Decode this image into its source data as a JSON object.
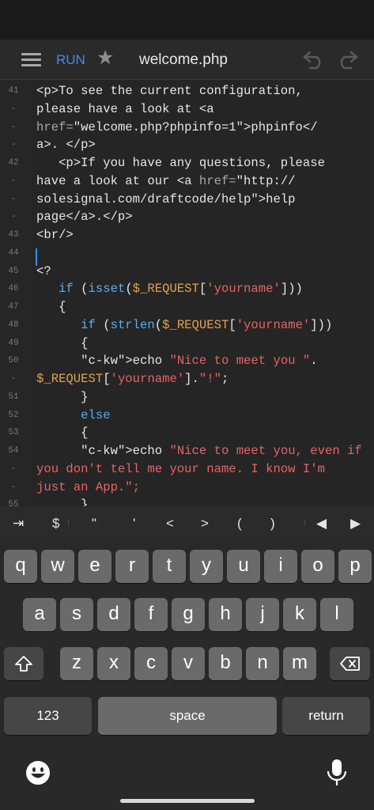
{
  "toolbar": {
    "run_label": "RUN",
    "title": "welcome.php"
  },
  "icons": {
    "menu": "hamburger-menu-icon",
    "favorite": "star-icon",
    "undo": "undo-icon",
    "redo": "redo-icon",
    "emoji": "emoji-icon",
    "mic": "microphone-icon",
    "delete": "backspace-icon",
    "shift": "shift-icon"
  },
  "editor": {
    "lines": [
      {
        "no": "41",
        "text": "<p>To see the current configuration,"
      },
      {
        "no": "-",
        "text": "please have a look at <a"
      },
      {
        "no": "-",
        "text": "href=\"welcome.php?phpinfo=1\">phpinfo</"
      },
      {
        "no": "-",
        "text": "a>. </p>"
      },
      {
        "no": "42",
        "text": "   <p>If you have any questions, please"
      },
      {
        "no": "-",
        "text": "have a look at our <a href=\"http://"
      },
      {
        "no": "-",
        "text": "solesignal.com/draftcode/help\">help"
      },
      {
        "no": "-",
        "text": "page</a>.</p>"
      },
      {
        "no": "43",
        "text": "<br/>"
      },
      {
        "no": "44",
        "text": ""
      },
      {
        "no": "45",
        "text": "<?"
      },
      {
        "no": "46",
        "text": "   if (isset($_REQUEST['yourname']))"
      },
      {
        "no": "47",
        "text": "   {"
      },
      {
        "no": "48",
        "text": "      if (strlen($_REQUEST['yourname']))"
      },
      {
        "no": "49",
        "text": "      {"
      },
      {
        "no": "50",
        "text": "      echo \"Nice to meet you \"."
      },
      {
        "no": "-",
        "text": "$_REQUEST['yourname'].\"!\";"
      },
      {
        "no": "51",
        "text": "      }"
      },
      {
        "no": "52",
        "text": "      else"
      },
      {
        "no": "53",
        "text": "      {"
      },
      {
        "no": "54",
        "text": "      echo \"Nice to meet you, even if"
      },
      {
        "no": "-",
        "text": "you don't tell me your name. I know I'm"
      },
      {
        "no": "-",
        "text": "just an App.\";"
      },
      {
        "no": "55",
        "text": "      }"
      }
    ]
  },
  "accessory_bar": {
    "keys": [
      "⇥",
      "$",
      "\"",
      "'",
      "<",
      ">",
      "(",
      ")",
      "◀",
      "▶"
    ]
  },
  "keyboard": {
    "row1": [
      "q",
      "w",
      "e",
      "r",
      "t",
      "y",
      "u",
      "i",
      "o",
      "p"
    ],
    "row2": [
      "a",
      "s",
      "d",
      "f",
      "g",
      "h",
      "j",
      "k",
      "l"
    ],
    "row3": [
      "z",
      "x",
      "c",
      "v",
      "b",
      "n",
      "m"
    ],
    "numbers_label": "123",
    "space_label": "space",
    "return_label": "return"
  }
}
